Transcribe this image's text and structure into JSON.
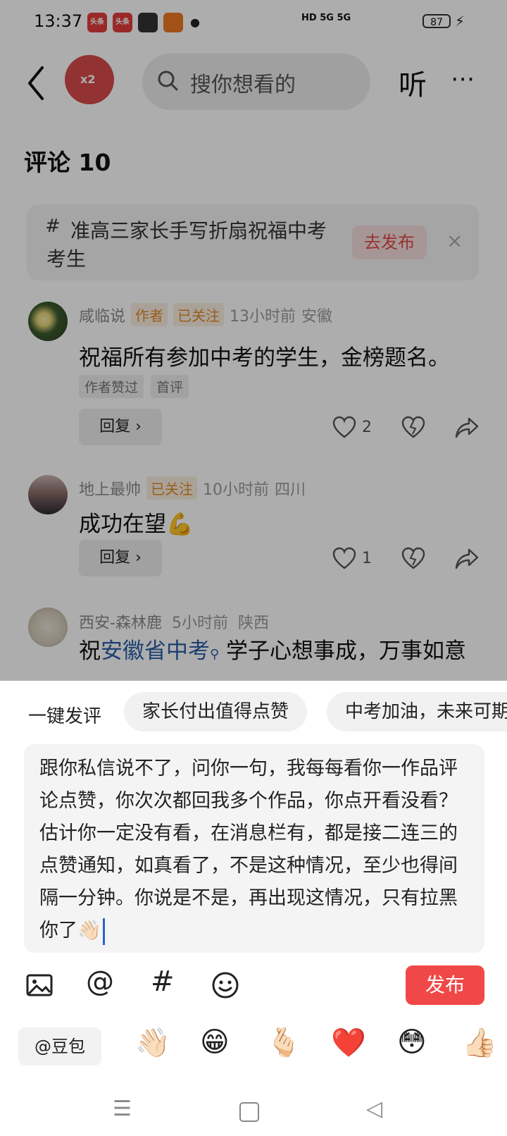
{
  "status_bar": {
    "time": "13:37",
    "app_badges": [
      "头条",
      "头条",
      "",
      ""
    ],
    "network": "HD 5G 5G",
    "battery": "87"
  },
  "top_bar": {
    "search_placeholder": "搜你想看的",
    "listen_label": "听",
    "more_label": "⋯",
    "coin_label": "x2"
  },
  "comments_header": "评论 10",
  "topic_card": {
    "text": "准高三家长手写折扇祝福中考考生",
    "publish_label": "去发布",
    "close_label": "×"
  },
  "comments": [
    {
      "username": "咸临说",
      "tags": [
        "作者",
        "已关注"
      ],
      "time": "13小时前",
      "location": "安徽",
      "text": "祝福所有参加中考的学生，金榜题名。",
      "badges": [
        "作者赞过",
        "首评"
      ],
      "reply_label": "回复 ›",
      "likes": "2"
    },
    {
      "username": "地上最帅",
      "tags": [
        "已关注"
      ],
      "time": "10小时前",
      "location": "四川",
      "text": "成功在望💪",
      "reply_label": "回复 ›",
      "likes": "1"
    },
    {
      "username": "西安-森林鹿",
      "time": "5小时前",
      "location": "陕西",
      "text_prefix": "祝",
      "text_link": "安徽省中考",
      "text_suffix": " 学子心想事成，万事如意"
    }
  ],
  "compose": {
    "quick_label": "一键发评",
    "quick_chips": [
      "家长付出值得点赞",
      "中考加油，未来可期"
    ],
    "draft_text": "跟你私信说不了，问你一句，我每每看你一作品评论点赞，你次次都回我多个作品，你点开看没看？估计你一定没有看，在消息栏有，都是接二连三的点赞通知，如真看了，不是这种情况，至少也得间隔一分钟。你说是不是，再出现这情况，只有拉黑你了👋🏻",
    "publish_label": "发布",
    "mention_label": "@豆包",
    "tool_icons": [
      "image-icon",
      "at-icon",
      "hashtag-icon",
      "emoji-icon"
    ],
    "emojis": [
      "👋🏻",
      "😁",
      "🫰🏻",
      "❤️",
      "😳",
      "👍🏻"
    ]
  },
  "colors": {
    "accent_red": "#f04848",
    "link_blue": "#2b5ea8",
    "tag_orange": "#e08a2a"
  }
}
